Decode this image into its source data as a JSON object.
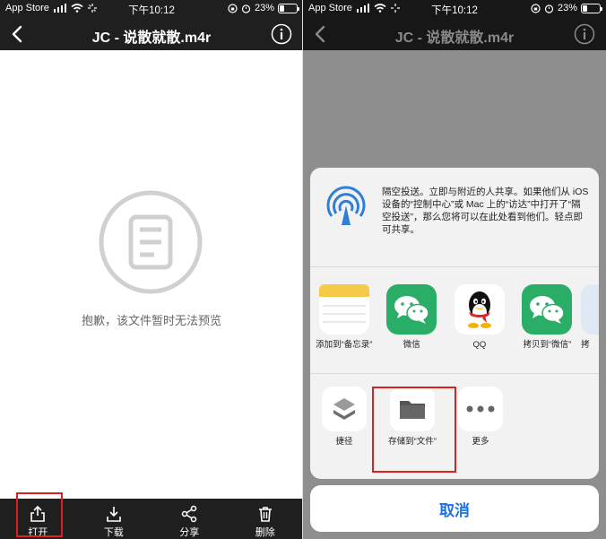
{
  "status_bar": {
    "carrier": "App Store",
    "time": "下午10:12",
    "battery": "23%"
  },
  "viewer": {
    "title": "JC - 说散就散.m4r",
    "empty_message": "抱歉，该文件暂时无法预览",
    "toolbar": {
      "open_label": "打开",
      "download_label": "下载",
      "share_label": "分享",
      "delete_label": "删除"
    }
  },
  "share_sheet": {
    "airdrop_text": "隔空投送。立即与附近的人共享。如果他们从 iOS 设备的“控制中心”或 Mac 上的“访达”中打开了“隔空投送”，那么您将可以在此处看到他们。轻点即可共享。",
    "apps": [
      {
        "label": "添加到“备忘录”",
        "icon": "notes-icon"
      },
      {
        "label": "微信",
        "icon": "wechat-icon"
      },
      {
        "label": "QQ",
        "icon": "qq-icon"
      },
      {
        "label": "拷贝到“微信”",
        "icon": "wechat-icon"
      },
      {
        "label": "拷",
        "icon": "app-icon"
      }
    ],
    "actions": [
      {
        "label": "捷径",
        "icon": "shortcuts-icon"
      },
      {
        "label": "存储到“文件”",
        "icon": "folder-icon"
      },
      {
        "label": "更多",
        "icon": "more-icon"
      }
    ],
    "cancel_label": "取消"
  },
  "colors": {
    "bar_background": "#1f1f1f",
    "accent_blue": "#1a73e8",
    "highlight_red": "#e02020",
    "wechat_green": "#2aae67"
  }
}
